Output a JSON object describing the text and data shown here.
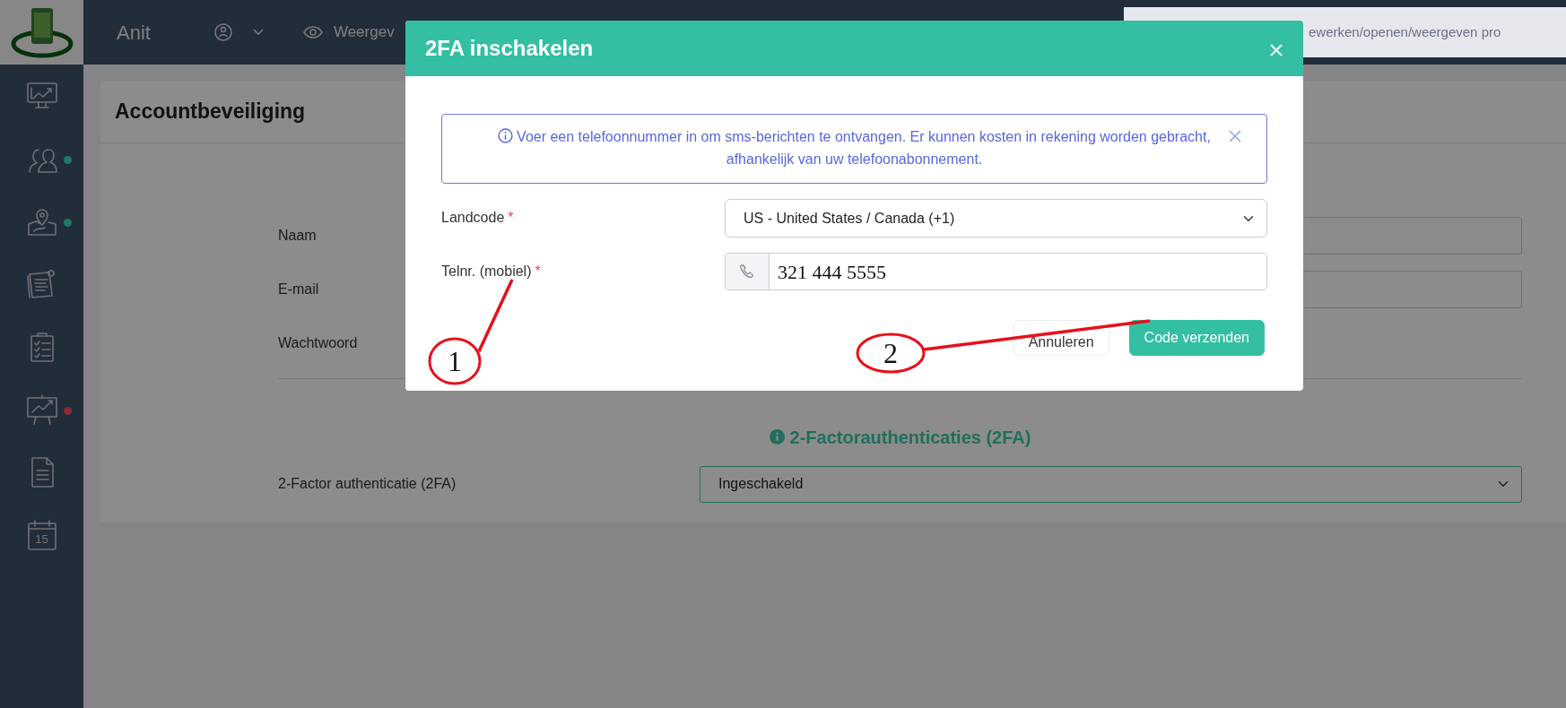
{
  "top_bar": {
    "brand": "Anit",
    "view_label": "Weergev",
    "search": {
      "placeholder": "ewerken/openen/weergeven pro"
    }
  },
  "sidebar": {
    "items": [
      {
        "badge": false
      },
      {
        "badge": true,
        "color": "#1f7a63"
      },
      {
        "badge": true,
        "color": "#1f7a63"
      },
      {
        "badge": false
      },
      {
        "badge": false
      },
      {
        "badge": true,
        "color": "#8a2a35"
      },
      {
        "badge": false
      },
      {
        "badge": false,
        "day": "15"
      }
    ]
  },
  "page": {
    "title": "Accountbeveiliging",
    "fields": [
      {
        "label": "Naam",
        "kind": "input"
      },
      {
        "label": "E-mail",
        "kind": "input"
      },
      {
        "label": "Wachtwoord",
        "kind": "label"
      }
    ],
    "section_title": "2-Factorauthenticaties (2FA)",
    "twofa": {
      "label": "2-Factor authenticatie (2FA)",
      "value": "Ingeschakeld"
    }
  },
  "modal": {
    "title": "2FA inschakelen",
    "alert": "Voer een telefoonnummer in om sms-berichten te ontvangen. Er kunnen kosten in rekening worden gebracht, afhankelijk van uw telefoonabonnement.",
    "fields": [
      {
        "label": "Landcode",
        "required_mark": "*",
        "kind": "select",
        "value": "US - United States / Canada (+1)"
      },
      {
        "label": "Telnr. (mobiel)",
        "required_mark": "*",
        "kind": "phone",
        "value": "321 444 5555"
      }
    ],
    "buttons": [
      {
        "label": "Annuleren",
        "kind": "secondary"
      },
      {
        "label": "Code verzenden",
        "kind": "primary"
      }
    ]
  },
  "annotations": [
    {
      "label": "1"
    },
    {
      "label": "2"
    }
  ]
}
